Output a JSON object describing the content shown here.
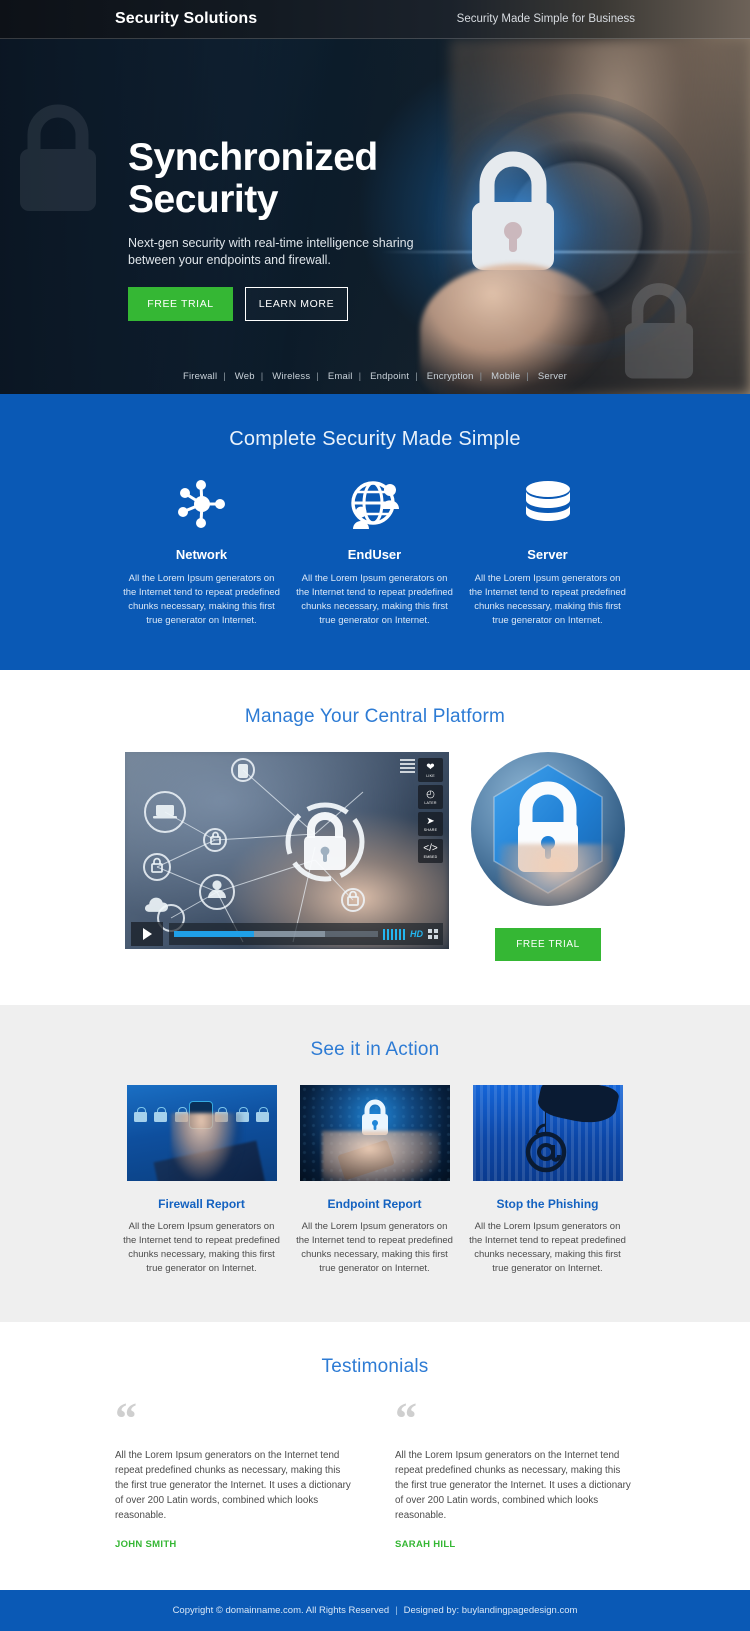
{
  "header": {
    "brand": "Security Solutions",
    "tagline": "Security Made Simple for Business"
  },
  "hero": {
    "title_line1": "Synchronized",
    "title_line2": "Security",
    "subtitle": "Next-gen security with real-time intelligence sharing between your endpoints and firewall.",
    "cta_primary": "FREE TRIAL",
    "cta_secondary": "LEARN MORE",
    "tags": [
      "Firewall",
      "Web",
      "Wireless",
      "Email",
      "Endpoint",
      "Encryption",
      "Mobile",
      "Server"
    ],
    "tag_separator": "|"
  },
  "features": {
    "title": "Complete Security Made Simple",
    "items": [
      {
        "icon": "network-nodes-icon",
        "title": "Network",
        "text": "All the Lorem Ipsum generators on the Internet tend to repeat predefined chunks necessary, making this first true generator on Internet."
      },
      {
        "icon": "globe-users-icon",
        "title": "EndUser",
        "text": "All the Lorem Ipsum generators on the Internet tend to repeat predefined chunks necessary, making this first true generator on Internet."
      },
      {
        "icon": "database-server-icon",
        "title": "Server",
        "text": "All the Lorem Ipsum generators on the Internet tend to repeat predefined chunks necessary, making this first true generator on Internet."
      }
    ]
  },
  "platform": {
    "title": "Manage Your Central Platform",
    "video": {
      "overlay_buttons": [
        {
          "icon": "heart-icon",
          "label": "LIKE"
        },
        {
          "icon": "clock-icon",
          "label": "LATER"
        },
        {
          "icon": "share-icon",
          "label": "SHARE"
        },
        {
          "icon": "embed-code-icon",
          "label": "EMBED"
        }
      ],
      "quality_label": "HD",
      "progress_percent": 39
    },
    "cta": "FREE TRIAL"
  },
  "action": {
    "title": "See it in Action",
    "cards": [
      {
        "image": "firewall-touchscreen-locks-image",
        "title": "Firewall Report",
        "text": "All the Lorem Ipsum generators on the Internet tend to repeat predefined chunks necessary, making this first true generator on Internet."
      },
      {
        "image": "mobile-endpoint-lock-image",
        "title": "Endpoint Report",
        "text": "All the Lorem Ipsum generators on the Internet tend to repeat predefined chunks necessary, making this first true generator on Internet."
      },
      {
        "image": "phishing-hook-email-image",
        "title": "Stop the Phishing",
        "text": "All the Lorem Ipsum generators on the Internet tend to repeat predefined chunks necessary, making this first true generator on Internet."
      }
    ]
  },
  "testimonials": {
    "title": "Testimonials",
    "quote_glyph": "“",
    "items": [
      {
        "text": "All the Lorem Ipsum generators on the Internet tend repeat predefined chunks as necessary, making this the first true generator the Internet. It uses a dictionary of over 200 Latin words, combined which looks reasonable.",
        "author": "JOHN SMITH"
      },
      {
        "text": "All the Lorem Ipsum generators on the Internet tend repeat predefined chunks as necessary, making this the first true generator the Internet. It uses a dictionary of over 200 Latin words, combined which looks reasonable.",
        "author": "SARAH HILL"
      }
    ]
  },
  "footer": {
    "copyright": "Copyright © domainname.com. All Rights Reserved",
    "separator": "|",
    "designed_by": "Designed by: buylandingpagedesign.com"
  },
  "colors": {
    "brand_blue": "#0a59b5",
    "accent_green": "#35b734",
    "title_blue": "#2d7bd4",
    "card_title_blue": "#1462c0",
    "grey_bg": "#efefef",
    "dark_header": "#0d1117"
  }
}
